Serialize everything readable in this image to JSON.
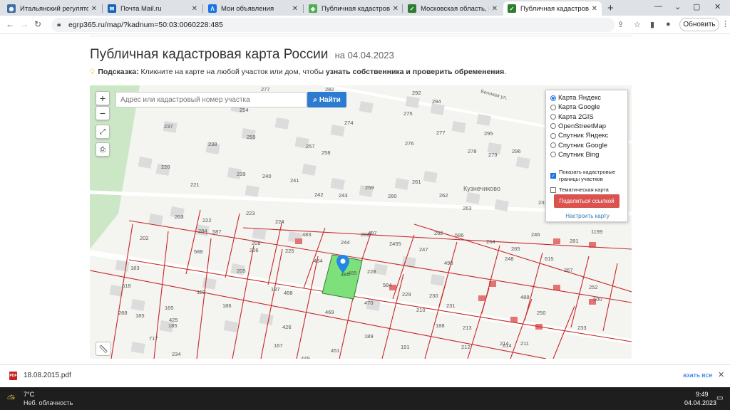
{
  "tabs": [
    {
      "title": "Итальянский регулятор ск",
      "fav_color": "#3a6ea5",
      "fav_glyph": "◉"
    },
    {
      "title": "Почта Mail.ru",
      "fav_color": "#1565c0",
      "fav_glyph": "✉"
    },
    {
      "title": "Мои объявления",
      "fav_color": "#1a73e8",
      "fav_glyph": "Λ"
    },
    {
      "title": "Публичная кадастровая к",
      "fav_color": "#4caf50",
      "fav_glyph": "◆"
    },
    {
      "title": "Московская область, Клин",
      "fav_color": "#2e7d32",
      "fav_glyph": "✓"
    },
    {
      "title": "Публичная кадастровая к",
      "fav_color": "#2e7d32",
      "fav_glyph": "✓"
    }
  ],
  "toolbar": {
    "url": "egrp365.ru/map/?kadnum=50:03:0060228:485",
    "update_label": "Обновить"
  },
  "page": {
    "title": "Публичная кадастровая карта России",
    "date": "на 04.04.2023",
    "hint_label": "Подсказка:",
    "hint_text": " Кликните на карте на любой участок или дом, чтобы ",
    "hint_bold": "узнать собственника и проверить обременения",
    "hint_end": "."
  },
  "map": {
    "search_placeholder": "Адрес или кадастровый номер участка",
    "search_button": "Найти",
    "zoom_in": "+",
    "zoom_out": "−",
    "layers": {
      "options": [
        "Карта Яндекс",
        "Карта Google",
        "Карта 2GIS",
        "OpenStreetMap",
        "Спутник Яндекс",
        "Спутник Google",
        "Спутник Bing"
      ],
      "selected": "Карта Яндекс",
      "show_borders": "Показать кадастровые границы участков",
      "thematic": "Тематическая карта",
      "share": "Поделиться ссылкой",
      "configure": "Настроить карту"
    },
    "place_label": "Кузнечиково",
    "street_label": "Беликая ул.",
    "selected_parcel": "485",
    "parcel_numbers": [
      {
        "n": "277"
      },
      {
        "n": "282"
      },
      {
        "n": "254"
      },
      {
        "n": "255"
      },
      {
        "n": "274"
      },
      {
        "n": "275"
      },
      {
        "n": "292"
      },
      {
        "n": "294"
      },
      {
        "n": "237"
      },
      {
        "n": "238"
      },
      {
        "n": "257"
      },
      {
        "n": "258"
      },
      {
        "n": "276"
      },
      {
        "n": "277"
      },
      {
        "n": "295"
      },
      {
        "n": "278"
      },
      {
        "n": "279"
      },
      {
        "n": "296"
      },
      {
        "n": "220"
      },
      {
        "n": "239"
      },
      {
        "n": "240"
      },
      {
        "n": "241"
      },
      {
        "n": "242"
      },
      {
        "n": "243"
      },
      {
        "n": "259"
      },
      {
        "n": "260"
      },
      {
        "n": "261"
      },
      {
        "n": "262"
      },
      {
        "n": "263"
      },
      {
        "n": "221"
      },
      {
        "n": "203"
      },
      {
        "n": "222"
      },
      {
        "n": "223"
      },
      {
        "n": "224"
      },
      {
        "n": "202"
      },
      {
        "n": "284"
      },
      {
        "n": "587"
      },
      {
        "n": "208"
      },
      {
        "n": "483"
      },
      {
        "n": "497"
      },
      {
        "n": "244"
      },
      {
        "n": "2455"
      },
      {
        "n": "262"
      },
      {
        "n": "586"
      },
      {
        "n": "264"
      },
      {
        "n": "265"
      },
      {
        "n": "246"
      },
      {
        "n": "247"
      },
      {
        "n": "498"
      },
      {
        "n": "588"
      },
      {
        "n": "206"
      },
      {
        "n": "225"
      },
      {
        "n": "484"
      },
      {
        "n": "485"
      },
      {
        "n": "228"
      },
      {
        "n": "248"
      },
      {
        "n": "615"
      },
      {
        "n": "267"
      },
      {
        "n": "183"
      },
      {
        "n": "205"
      },
      {
        "n": "584"
      },
      {
        "n": "229"
      },
      {
        "n": "230"
      },
      {
        "n": "231"
      },
      {
        "n": "252"
      },
      {
        "n": "618"
      },
      {
        "n": "183"
      },
      {
        "n": "186"
      },
      {
        "n": "187"
      },
      {
        "n": "468"
      },
      {
        "n": "469"
      },
      {
        "n": "470"
      },
      {
        "n": "210"
      },
      {
        "n": "488"
      },
      {
        "n": "250"
      },
      {
        "n": "500"
      },
      {
        "n": "268"
      },
      {
        "n": "185"
      },
      {
        "n": "165"
      },
      {
        "n": "425"
      },
      {
        "n": "185"
      },
      {
        "n": "188"
      },
      {
        "n": "213"
      },
      {
        "n": "614"
      },
      {
        "n": "233"
      },
      {
        "n": "717"
      },
      {
        "n": "426"
      },
      {
        "n": "189"
      },
      {
        "n": "211"
      },
      {
        "n": "234"
      },
      {
        "n": "167"
      },
      {
        "n": "449"
      },
      {
        "n": "451"
      },
      {
        "n": "191"
      },
      {
        "n": "212"
      },
      {
        "n": "214"
      },
      {
        "n": "233"
      },
      {
        "n": "281"
      },
      {
        "n": "1199"
      },
      {
        "n": "283"
      },
      {
        "n": "245"
      }
    ]
  },
  "download": {
    "file": "18.08.2015.pdf",
    "show_all": "азать все"
  },
  "taskbar": {
    "temp": "7°C",
    "weather": "Неб. облачность",
    "time": "9:49",
    "date": "04.04.2023"
  }
}
